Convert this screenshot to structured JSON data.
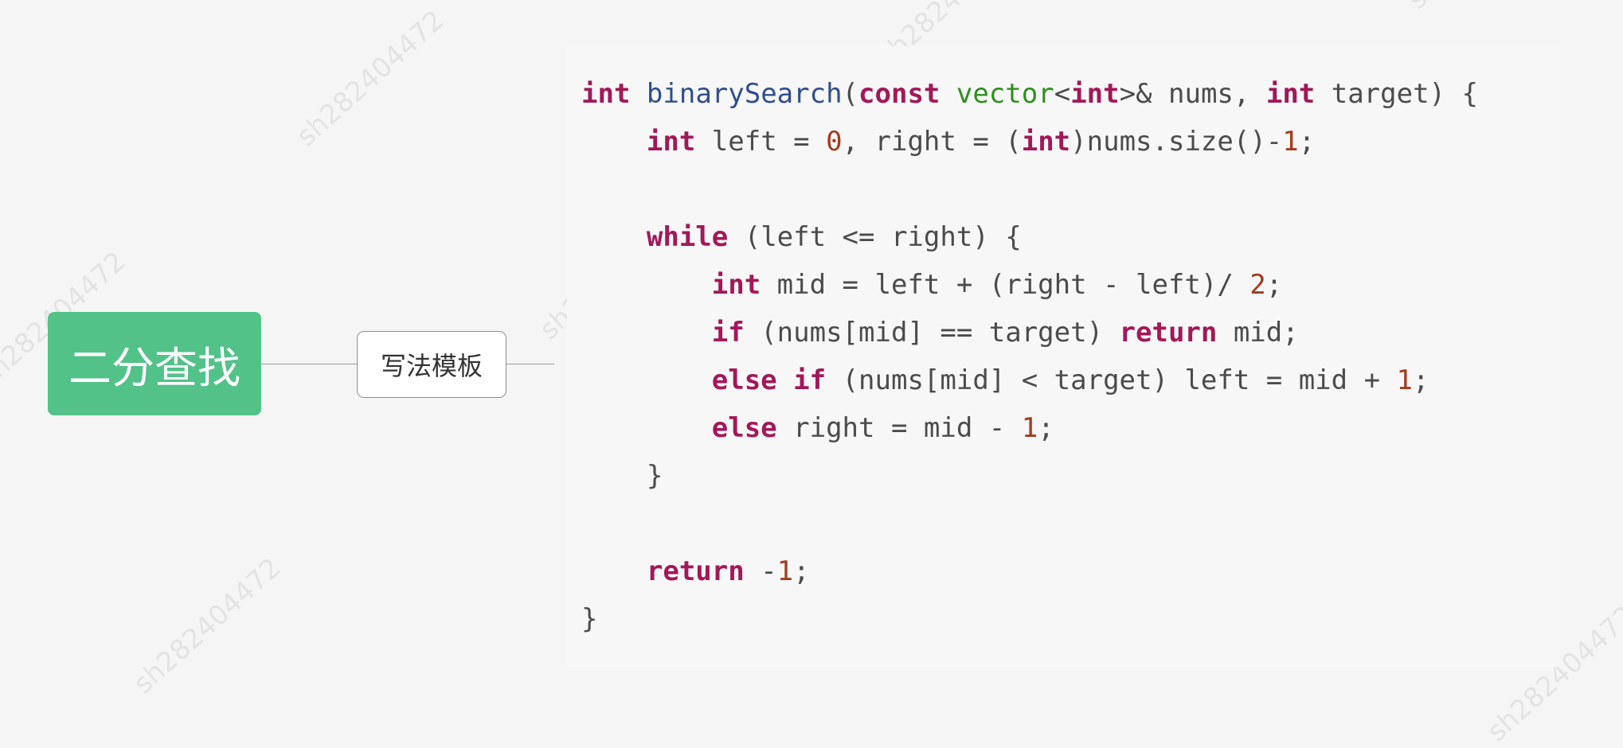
{
  "colors": {
    "root_fill": "#52c289",
    "keyword": "#a21858",
    "function": "#2f4e8c",
    "template": "#2f8f1f",
    "number": "#a33b1c",
    "plain": "#4b4b4b",
    "background": "#f5f5f5"
  },
  "watermark": {
    "text": "sh282404472"
  },
  "mindmap": {
    "root_label": "二分查找",
    "child_label": "写法模板"
  },
  "code": {
    "language": "cpp",
    "lines": [
      [
        {
          "t": "int",
          "c": "kw"
        },
        {
          "t": " ",
          "c": "plain"
        },
        {
          "t": "binarySearch",
          "c": "fn"
        },
        {
          "t": "(",
          "c": "plain"
        },
        {
          "t": "const",
          "c": "kw"
        },
        {
          "t": " ",
          "c": "plain"
        },
        {
          "t": "vector",
          "c": "template"
        },
        {
          "t": "<",
          "c": "plain"
        },
        {
          "t": "int",
          "c": "kw"
        },
        {
          "t": ">& nums, ",
          "c": "plain"
        },
        {
          "t": "int",
          "c": "kw"
        },
        {
          "t": " target) {",
          "c": "plain"
        }
      ],
      [
        {
          "t": "    ",
          "c": "plain"
        },
        {
          "t": "int",
          "c": "kw"
        },
        {
          "t": " left = ",
          "c": "plain"
        },
        {
          "t": "0",
          "c": "num"
        },
        {
          "t": ", right = (",
          "c": "plain"
        },
        {
          "t": "int",
          "c": "kw"
        },
        {
          "t": ")nums.size()-",
          "c": "plain"
        },
        {
          "t": "1",
          "c": "num"
        },
        {
          "t": ";",
          "c": "plain"
        }
      ],
      [],
      [
        {
          "t": "    ",
          "c": "plain"
        },
        {
          "t": "while",
          "c": "kw"
        },
        {
          "t": " (left <= right) {",
          "c": "plain"
        }
      ],
      [
        {
          "t": "        ",
          "c": "plain"
        },
        {
          "t": "int",
          "c": "kw"
        },
        {
          "t": " mid = left + (right - left)/ ",
          "c": "plain"
        },
        {
          "t": "2",
          "c": "num"
        },
        {
          "t": ";",
          "c": "plain"
        }
      ],
      [
        {
          "t": "        ",
          "c": "plain"
        },
        {
          "t": "if",
          "c": "kw"
        },
        {
          "t": " (nums[mid] == target) ",
          "c": "plain"
        },
        {
          "t": "return",
          "c": "kw"
        },
        {
          "t": " mid;",
          "c": "plain"
        }
      ],
      [
        {
          "t": "        ",
          "c": "plain"
        },
        {
          "t": "else",
          "c": "kw"
        },
        {
          "t": " ",
          "c": "plain"
        },
        {
          "t": "if",
          "c": "kw"
        },
        {
          "t": " (nums[mid] < target) left = mid + ",
          "c": "plain"
        },
        {
          "t": "1",
          "c": "num"
        },
        {
          "t": ";",
          "c": "plain"
        }
      ],
      [
        {
          "t": "        ",
          "c": "plain"
        },
        {
          "t": "else",
          "c": "kw"
        },
        {
          "t": " right = mid - ",
          "c": "plain"
        },
        {
          "t": "1",
          "c": "num"
        },
        {
          "t": ";",
          "c": "plain"
        }
      ],
      [
        {
          "t": "    }",
          "c": "plain"
        }
      ],
      [],
      [
        {
          "t": "    ",
          "c": "plain"
        },
        {
          "t": "return",
          "c": "kw"
        },
        {
          "t": " -",
          "c": "plain"
        },
        {
          "t": "1",
          "c": "num"
        },
        {
          "t": ";",
          "c": "plain"
        }
      ],
      [
        {
          "t": "}",
          "c": "plain"
        }
      ]
    ]
  }
}
